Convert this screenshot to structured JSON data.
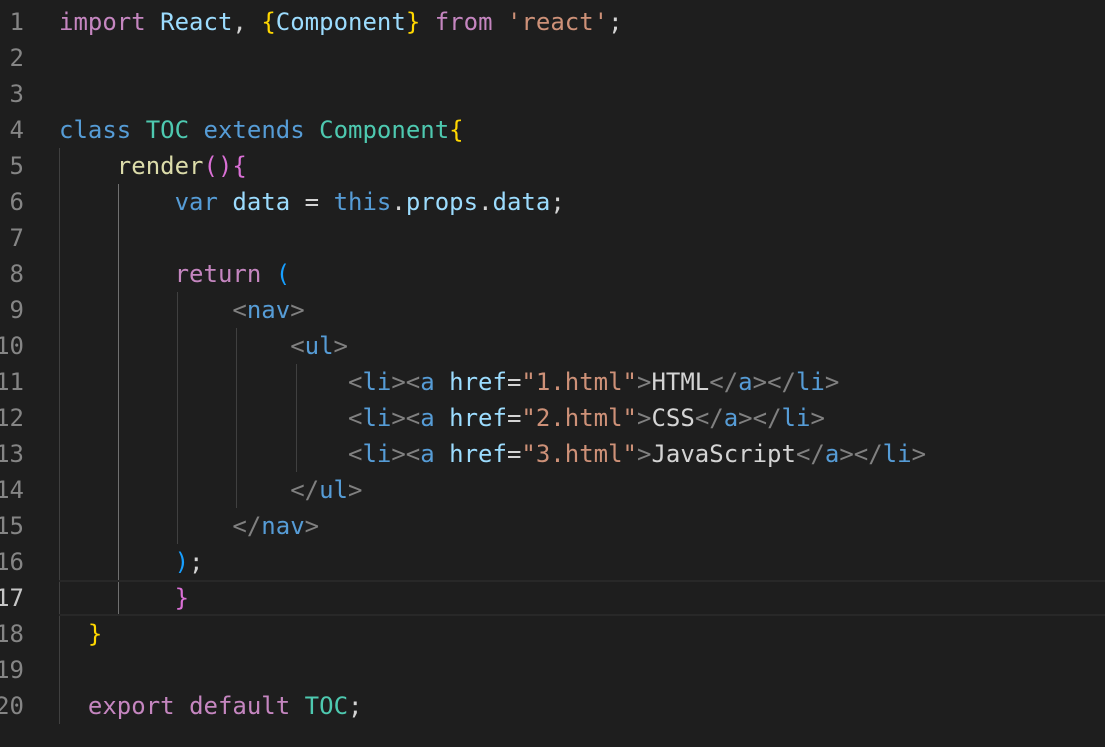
{
  "editor": {
    "active_line": 17,
    "line_numbers": [
      "1",
      "2",
      "3",
      "4",
      "5",
      "6",
      "7",
      "8",
      "9",
      "10",
      "11",
      "12",
      "13",
      "14",
      "15",
      "16",
      "17",
      "18",
      "19",
      "20"
    ],
    "tokens": {
      "l1": [
        "import",
        " ",
        "React",
        ", ",
        "{",
        "Component",
        "}",
        " ",
        "from",
        " ",
        "'react'",
        ";"
      ],
      "l4": [
        "class",
        " ",
        "TOC",
        " ",
        "extends",
        " ",
        "Component",
        "{"
      ],
      "l5": [
        "render",
        "(",
        ")",
        "{"
      ],
      "l6": [
        "var",
        " ",
        "data",
        " = ",
        "this",
        ".",
        "props",
        ".",
        "data",
        ";"
      ],
      "l8": [
        "return",
        " ",
        "("
      ],
      "l9": [
        "<",
        "nav",
        ">"
      ],
      "l10": [
        "<",
        "ul",
        ">"
      ],
      "l11": [
        "<",
        "li",
        ">",
        "<",
        "a",
        " ",
        "href",
        "=",
        "\"1.html\"",
        ">",
        "HTML",
        "</",
        "a",
        ">",
        "</",
        "li",
        ">"
      ],
      "l12": [
        "<",
        "li",
        ">",
        "<",
        "a",
        " ",
        "href",
        "=",
        "\"2.html\"",
        ">",
        "CSS",
        "</",
        "a",
        ">",
        "</",
        "li",
        ">"
      ],
      "l13": [
        "<",
        "li",
        ">",
        "<",
        "a",
        " ",
        "href",
        "=",
        "\"3.html\"",
        ">",
        "JavaScript",
        "</",
        "a",
        ">",
        "</",
        "li",
        ">"
      ],
      "l14": [
        "</",
        "ul",
        ">"
      ],
      "l15": [
        "</",
        "nav",
        ">"
      ],
      "l16": [
        ")",
        ";"
      ],
      "l17": [
        "}"
      ],
      "l18": [
        "}"
      ],
      "l20": [
        "export",
        " ",
        "default",
        " ",
        "TOC",
        ";"
      ]
    }
  },
  "colors": {
    "background": "#1e1e1e",
    "keyword": "#c586c0",
    "storage": "#569cd6",
    "class": "#4ec9b0",
    "variable": "#9cdcfe",
    "function": "#dcdcaa",
    "string": "#ce9178",
    "bracket_gold": "#ffd700",
    "bracket_orchid": "#da70d6",
    "bracket_blue": "#179fff",
    "line_number": "#858585"
  }
}
